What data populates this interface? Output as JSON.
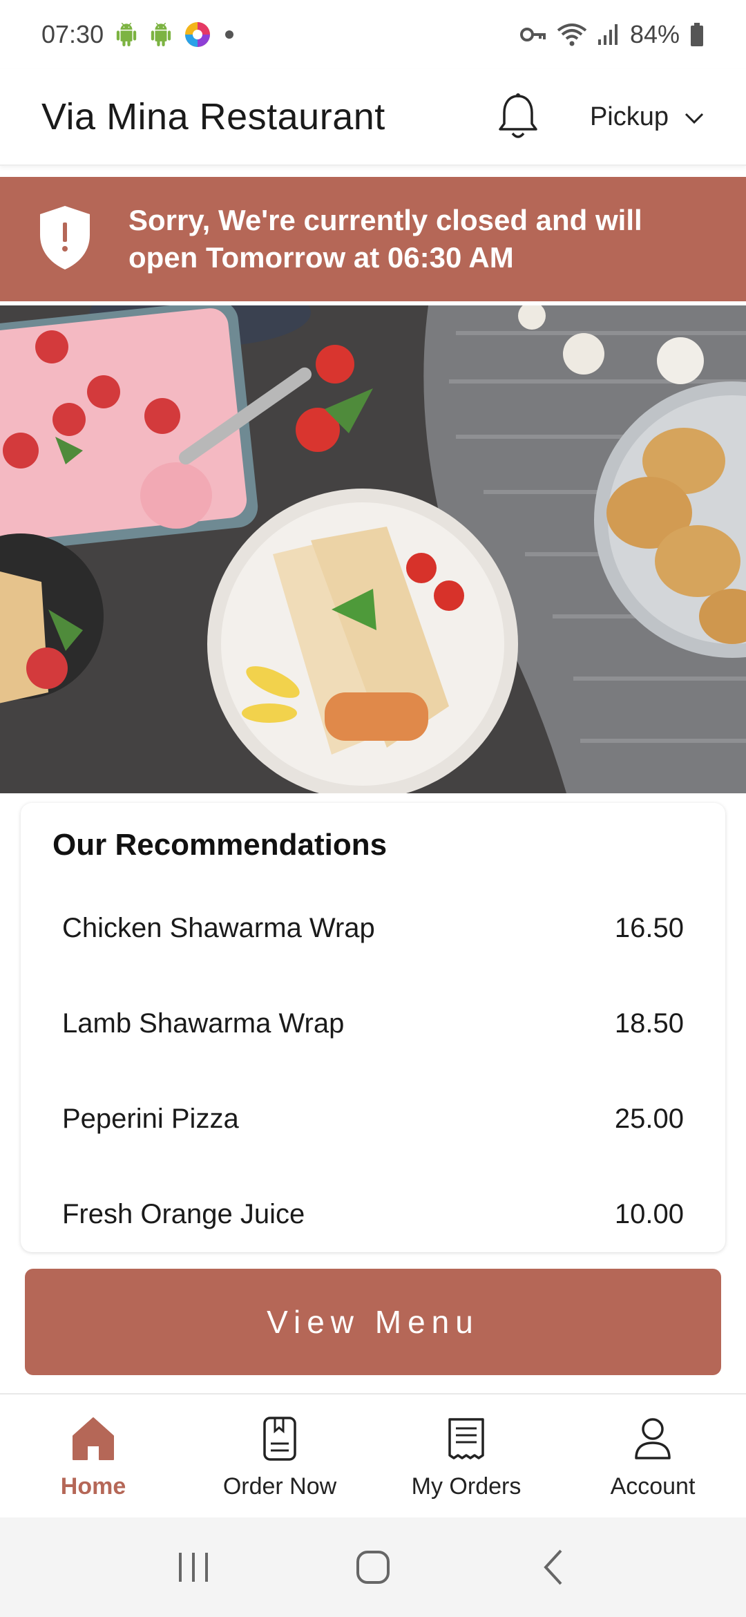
{
  "status_bar": {
    "time": "07:30",
    "battery": "84%",
    "icons": [
      "android-icon",
      "android-icon",
      "app-notification-icon",
      "dot-icon",
      "vpn-key-icon",
      "wifi-icon",
      "signal-icon",
      "battery-icon"
    ]
  },
  "header": {
    "restaurant_name": "Via Mina Restaurant",
    "order_type": "Pickup",
    "icons": [
      "bell-icon",
      "chevron-down-icon"
    ]
  },
  "banner": {
    "message": "Sorry, We're currently closed and will open Tomorrow at 06:30 AM",
    "icon": "shield-alert-icon",
    "color": "#b56757"
  },
  "hero": {
    "description_icon": "food-hero-image"
  },
  "recommendations": {
    "title": "Our Recommendations",
    "items": [
      {
        "name": "Chicken Shawarma Wrap",
        "price": "16.50"
      },
      {
        "name": "Lamb Shawarma Wrap",
        "price": "18.50"
      },
      {
        "name": "Peperini Pizza",
        "price": "25.00"
      },
      {
        "name": "Fresh Orange Juice",
        "price": "10.00"
      }
    ]
  },
  "view_menu": {
    "label": "View Menu"
  },
  "bottom_nav": {
    "items": [
      {
        "label": "Home",
        "icon": "home-icon",
        "active": true
      },
      {
        "label": "Order Now",
        "icon": "order-book-icon",
        "active": false
      },
      {
        "label": "My Orders",
        "icon": "receipt-icon",
        "active": false
      },
      {
        "label": "Account",
        "icon": "user-icon",
        "active": false
      }
    ]
  },
  "system_nav": {
    "icons": [
      "recent-apps-icon",
      "home-circle-icon",
      "back-icon"
    ]
  },
  "colors": {
    "accent": "#b56757",
    "text": "#111111",
    "nav_bg": "#f4f4f4"
  }
}
